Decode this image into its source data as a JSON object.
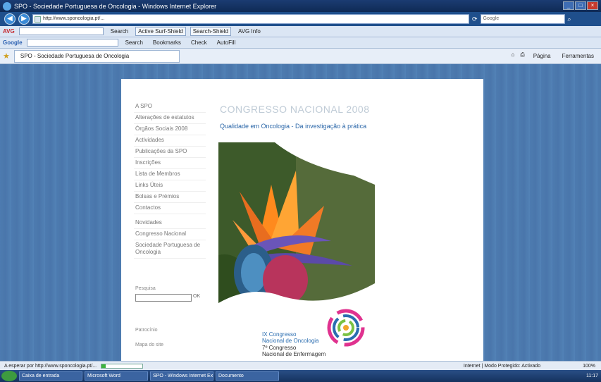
{
  "window": {
    "title": "SPO - Sociedade Portuguesa de Oncologia - Windows Internet Explorer"
  },
  "address": {
    "url": "http://www.sponcologia.pt/..."
  },
  "search": {
    "placeholder": "Google"
  },
  "toolbar1": {
    "brand": "AVG",
    "search_label": "Search",
    "items": [
      "Active Surf-Shield",
      "Search-Shield",
      "AVG Info"
    ]
  },
  "toolbar2": {
    "brand": "Google",
    "go_label": "Search",
    "items": [
      "Bookmarks",
      "Check",
      "AutoFill"
    ]
  },
  "tab": {
    "title": "SPO - Sociedade Portuguesa de Oncologia"
  },
  "commandbar": {
    "page_label": "Página",
    "tools_label": "Ferramentas"
  },
  "sidenav": {
    "items": [
      "A SPO",
      "Alterações de estatutos",
      "Órgãos Sociais 2008",
      "Actividades",
      "Publicações da SPO",
      "Inscrições",
      "Lista de Membros",
      "Links Úteis",
      "Bolsas e Prémios",
      "Contactos",
      "Novidades",
      "Congresso Nacional",
      "Sociedade Portuguesa de Oncologia"
    ]
  },
  "sidebar": {
    "search_label": "Pesquisa",
    "search_go": "OK",
    "sponsor_label": "Patrocínio",
    "footer_link": "Mapa do site"
  },
  "main": {
    "heading": "CONGRESSO NACIONAL 2008",
    "subheading": "Qualidade em Oncologia - Da investigação à prática",
    "congress_line1": "IX Congresso",
    "congress_line2": "Nacional de Oncologia",
    "congress_line3": "7º Congresso",
    "congress_line4": "Nacional de Enfermagem"
  },
  "status": {
    "text": "A esperar por http://www.sponcologia.pt/...",
    "zone": "Internet | Modo Protegido: Activado",
    "zoom": "100%",
    "progress": 0.1
  },
  "taskbar": {
    "tasks": [
      "Caixa de entrada",
      "Microsoft Word",
      "SPO - Windows Internet Explorer",
      "Documento"
    ],
    "clock": "11:17"
  }
}
